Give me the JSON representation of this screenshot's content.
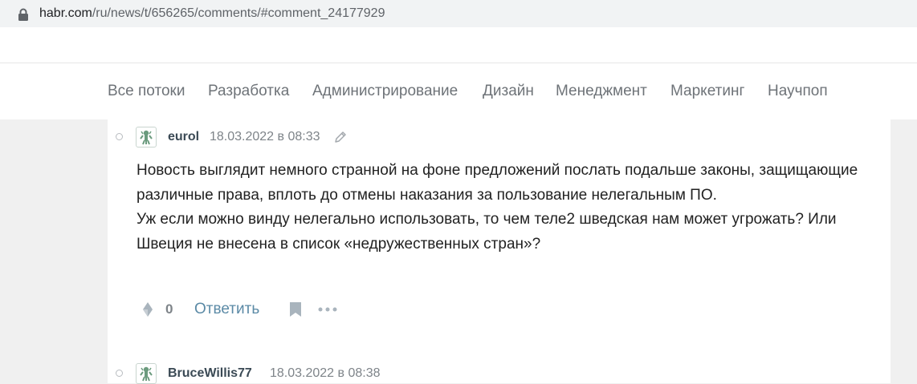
{
  "browser": {
    "url_host": "habr.com",
    "url_path": "/ru/news/t/656265/comments/#comment_24177929",
    "lock_icon": "lock-icon"
  },
  "nav": {
    "items": [
      {
        "label": "Все потоки"
      },
      {
        "label": "Разработка"
      },
      {
        "label": "Администрирование"
      },
      {
        "label": "Дизайн"
      },
      {
        "label": "Менеджмент"
      },
      {
        "label": "Маркетинг"
      },
      {
        "label": "Научпоп"
      }
    ]
  },
  "comments": [
    {
      "username": "eurol",
      "timestamp": "18.03.2022 в 08:33",
      "edited_icon": "pencil-icon",
      "text": [
        "Новость выглядит немного странной на фоне предложений послать подальше законы, защищающие различные права, вплоть до отмены наказания за пользование нелегальным ПО.",
        "Уж если можно винду нелегально использовать, то чем теле2 шведская нам может угрожать? Или Швеция не внесена в список «недружественных стран»?"
      ],
      "votes": "0",
      "reply_label": "Ответить"
    },
    {
      "username": "BruceWillis77",
      "timestamp": "18.03.2022 в 08:38"
    }
  ],
  "colors": {
    "nav_text": "#6e7378",
    "username": "#3b4a55",
    "link": "#5b8aa6",
    "avatar_green": "#6b9b7e"
  }
}
